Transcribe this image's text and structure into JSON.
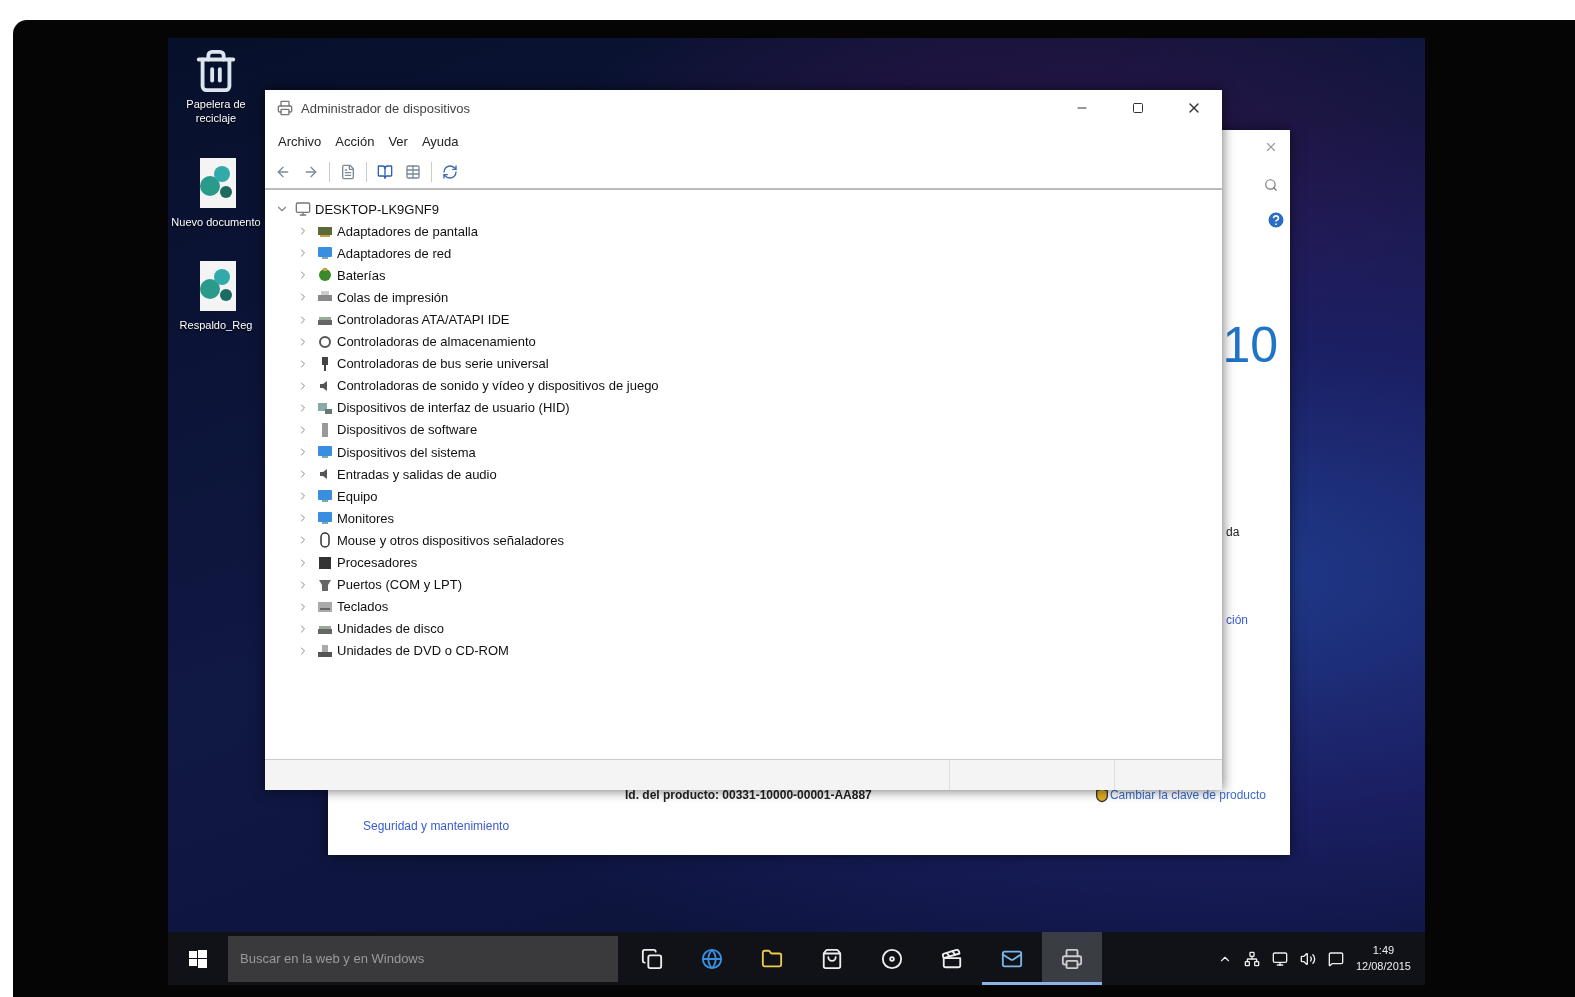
{
  "desktop_icons": [
    {
      "label": "Papelera de reciclaje"
    },
    {
      "label": "Nuevo documento"
    },
    {
      "label": "Respaldo_Reg"
    }
  ],
  "background_window": {
    "heading_fragment": "10",
    "text_fragment": "da",
    "link_fragment": "ción",
    "footer_link": "Seguridad y mantenimiento",
    "product_id": "Id. del producto: 00331-10000-00001-AA887",
    "change_key_link": "Cambiar la clave de producto"
  },
  "device_manager": {
    "title": "Administrador de dispositivos",
    "menu": [
      "Archivo",
      "Acción",
      "Ver",
      "Ayuda"
    ],
    "tree": {
      "label": "DESKTOP-LK9GNF9",
      "expanded": true,
      "children": [
        {
          "label": "Adaptadores de pantalla",
          "expanded": false
        },
        {
          "label": "Adaptadores de red",
          "expanded": false
        },
        {
          "label": "Baterías",
          "expanded": false
        },
        {
          "label": "Colas de impresión",
          "expanded": false
        },
        {
          "label": "Controladoras ATA/ATAPI IDE",
          "expanded": false
        },
        {
          "label": "Controladoras de almacenamiento",
          "expanded": false
        },
        {
          "label": "Controladoras de bus serie universal",
          "expanded": false
        },
        {
          "label": "Controladoras de sonido y vídeo y dispositivos de juego",
          "expanded": false
        },
        {
          "label": "Dispositivos de interfaz de usuario (HID)",
          "expanded": false
        },
        {
          "label": "Dispositivos de software",
          "expanded": false
        },
        {
          "label": "Dispositivos del sistema",
          "expanded": false
        },
        {
          "label": "Entradas y salidas de audio",
          "expanded": false
        },
        {
          "label": "Equipo",
          "expanded": false
        },
        {
          "label": "Monitores",
          "expanded": false
        },
        {
          "label": "Mouse y otros dispositivos señaladores",
          "expanded": false
        },
        {
          "label": "Procesadores",
          "expanded": false
        },
        {
          "label": "Puertos (COM y LPT)",
          "expanded": false
        },
        {
          "label": "Teclados",
          "expanded": false
        },
        {
          "label": "Unidades de disco",
          "expanded": false
        },
        {
          "label": "Unidades de DVD o CD-ROM",
          "expanded": false
        }
      ]
    }
  },
  "taskbar": {
    "search": {
      "placeholder": "Buscar en la web y en Windows"
    },
    "apps": [
      {
        "running": false,
        "selected": false
      },
      {
        "running": false,
        "selected": false
      },
      {
        "running": false,
        "selected": false
      },
      {
        "running": false,
        "selected": false
      },
      {
        "running": false,
        "selected": false
      },
      {
        "running": false,
        "selected": false
      },
      {
        "running": true,
        "selected": false
      },
      {
        "running": true,
        "selected": true
      }
    ],
    "clock": {
      "time": "1:49",
      "date": "12/08/2015"
    }
  }
}
